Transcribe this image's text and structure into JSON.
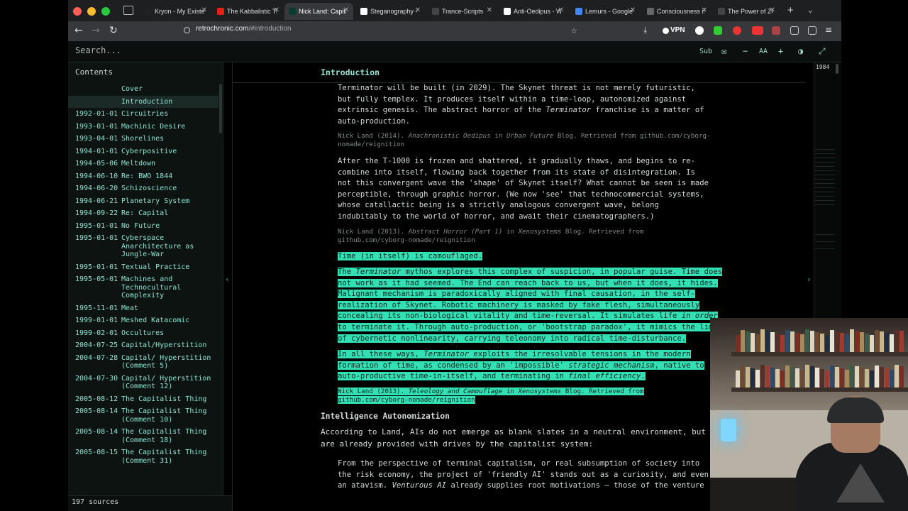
{
  "browser": {
    "tabs": [
      {
        "label": "Kryon - My Existence",
        "fav_color": "#222"
      },
      {
        "label": "The Kabbalistic Tree",
        "fav_color": "#e62117"
      },
      {
        "label": "Nick Land: Capitalism",
        "fav_color": "#0a3b33",
        "active": true
      },
      {
        "label": "Steganography - Wiki",
        "fav_color": "#fff"
      },
      {
        "label": "Trance-Scripts",
        "fav_color": "#444"
      },
      {
        "label": "Anti-Oedipus - Wiki",
        "fav_color": "#fff"
      },
      {
        "label": "Lemurs - Google Search",
        "fav_color": "#4285f4"
      },
      {
        "label": "Consciousness is",
        "fav_color": "#666"
      },
      {
        "label": "The Power of Zero -",
        "fav_color": "#444"
      }
    ],
    "url_host": "retrochronic.com",
    "url_path": "/#introduction",
    "vpn_label": "VPN"
  },
  "toolbar": {
    "search_placeholder": "Search...",
    "sub_label": "Sub",
    "font_label": "AA"
  },
  "sidebar": {
    "heading": "Contents",
    "items": [
      {
        "date": "",
        "title": "Cover"
      },
      {
        "date": "",
        "title": "Introduction",
        "active": true
      },
      {
        "date": "1992-01-01",
        "title": "Circuitries"
      },
      {
        "date": "1993-01-01",
        "title": "Machinic Desire"
      },
      {
        "date": "1993-04-01",
        "title": "Shorelines"
      },
      {
        "date": "1994-01-01",
        "title": "Cyberpositive"
      },
      {
        "date": "1994-05-06",
        "title": "Meltdown"
      },
      {
        "date": "1994-06-10",
        "title": "Re: BWO 1844"
      },
      {
        "date": "1994-06-20",
        "title": "Schizoscience"
      },
      {
        "date": "1994-06-21",
        "title": "Planetary System"
      },
      {
        "date": "1994-09-22",
        "title": "Re: Capital"
      },
      {
        "date": "1995-01-01",
        "title": "No Future"
      },
      {
        "date": "1995-01-01",
        "title": "Cyberspace Anarchitecture as Jungle-War"
      },
      {
        "date": "1995-01-01",
        "title": "Textual Practice"
      },
      {
        "date": "1995-05-01",
        "title": "Machines and Technocultural Complexity"
      },
      {
        "date": "1995-11-01",
        "title": "Meat"
      },
      {
        "date": "1999-01-01",
        "title": "Meshed Katacomic"
      },
      {
        "date": "1999-02-01",
        "title": "Occultures"
      },
      {
        "date": "2004-07-25",
        "title": "Capital/Hyperstition"
      },
      {
        "date": "2004-07-28",
        "title": "Capital/ Hyperstition (Comment 5)"
      },
      {
        "date": "2004-07-30",
        "title": "Capital/ Hyperstition (Comment 12)"
      },
      {
        "date": "2005-08-12",
        "title": "The Capitalist Thing"
      },
      {
        "date": "2005-08-14",
        "title": "The Capitalist Thing (Comment 10)"
      },
      {
        "date": "2005-08-14",
        "title": "The Capitalist Thing (Comment 18)"
      },
      {
        "date": "2005-08-15",
        "title": "The Capitalist Thing (Comment 31)"
      }
    ],
    "sources_count": "197 sources"
  },
  "main": {
    "section_title": "Introduction",
    "year_marker": "1984",
    "p1": "Terminator will be built (in 2029). The Skynet threat is not merely futuristic, but fully templex. It produces itself within a time-loop, autonomized against extrinsic genesis. The abstract horror of the ",
    "p1_em": "Terminator",
    "p1_end": " franchise is a matter of auto-production.",
    "cite1_author": "Nick Land (2014). ",
    "cite1_title": "Anachronistic Oedipus",
    "cite1_in": " in ",
    "cite1_source": "Urban Future",
    "cite1_rest": " Blog. Retrieved from github.com/cyborg-nomade/reignition",
    "p2": "After the T-1000 is frozen and shattered, it gradually thaws, and begins to re-combine into itself, flowing back together from its state of disintegration. Is not this convergent wave the 'shape' of Skynet itself? What cannot be seen is made perceptible, through graphic horror. (We now 'see' that technocommercial systems, whose catallactic being is a strictly analogous convergent wave, belong indubitably to the world of horror, and await their cinematographers.)",
    "cite2_author": "Nick Land (2013). ",
    "cite2_title": "Abstract Horror (Part 1)",
    "cite2_in": " in ",
    "cite2_source": "Xenosystems",
    "cite2_rest": " Blog. Retrieved from github.com/cyborg-nomade/reignition",
    "hl1": "Time (in itself) is camouflaged.",
    "hl2_a": "The ",
    "hl2_em1": "Terminator",
    "hl2_b": " mythos explores this complex of suspicion, in popular guise. Time does not work as it had seemed. The End can reach back to us, but when it does, it hides. Malignant mechanism is paradoxically aligned with final causation, in the self-realization of Skynet. Robotic machinery is masked by fake flesh, simultaneously concealing its non-biological vitality and time-reversal. It simulates life ",
    "hl2_em2": "in order",
    "hl2_c": " to terminate it. Through auto-production, or 'bootstrap paradox', it mimics the limi of cybernetic nonlinearity, carrying teleonomy into radical time-disturbance.",
    "hl3_a": "In all these ways, ",
    "hl3_em1": "Terminator",
    "hl3_b": " exploits the irresolvable tensions in the modern formation of time, as condensed by an 'impossible' ",
    "hl3_em2": "strategic mechanism",
    "hl3_c": ", native to auto-productive time-in-itself, and terminating in ",
    "hl3_em3": "final efficiency",
    "hl3_d": ".",
    "cite3_author": "Nick Land (2013). ",
    "cite3_title": "Teleology and Camouflage",
    "cite3_in": " in ",
    "cite3_source": "Xenosystems",
    "cite3_rest": " Blog. Retrieved from github.com/cyborg-nomade/reignition",
    "h2": "Intelligence Autonomization",
    "p3": "According to Land, AIs do not emerge as blank slates in a neutral environment, but are already provided with drives by the capitalist system:",
    "p4_a": "From the perspective of terminal capitalism, or real subsumption of society into the risk economy, the project of 'friendly AI' stands out as a curiosity, and even an atavism. ",
    "p4_em": "Venturous AI",
    "p4_b": " already supplies root motivations — those of the venture"
  },
  "colors": {
    "accent": "#8fe3d2",
    "highlight": "#33e0b4",
    "background": "#000000"
  }
}
